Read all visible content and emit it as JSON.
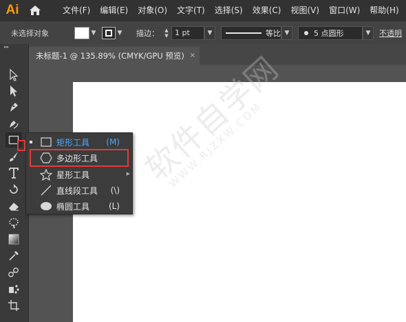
{
  "app": {
    "logo": "Ai"
  },
  "menu": [
    "文件(F)",
    "编辑(E)",
    "对象(O)",
    "文字(T)",
    "选择(S)",
    "效果(C)",
    "视图(V)",
    "窗口(W)",
    "帮助(H)"
  ],
  "control_bar": {
    "selection_label": "未选择对象",
    "stroke_label": "描边：",
    "stroke_value": "1 pt",
    "line_style_label": "等比",
    "brush_label": "5 点圆形",
    "opacity_label": "不透明"
  },
  "document_tab": {
    "title": "未标题-1 @ 135.89% (CMYK/GPU 预览)",
    "close_glyph": "×"
  },
  "flyout": {
    "items": [
      {
        "label": "矩形工具",
        "key": "(M)",
        "icon": "rectangle-icon",
        "active": true
      },
      {
        "label": "多边形工具",
        "key": "",
        "icon": "polygon-icon",
        "active": false
      },
      {
        "label": "星形工具",
        "key": "",
        "icon": "star-icon",
        "active": false
      },
      {
        "label": "直线段工具",
        "key": "(\\)",
        "icon": "line-segment-icon",
        "active": false
      },
      {
        "label": "椭圆工具",
        "key": "(L)",
        "icon": "ellipse-icon",
        "active": false
      }
    ]
  },
  "tools": [
    "selection-tool-icon",
    "direct-selection-tool-icon",
    "pen-tool-icon",
    "curvature-tool-icon",
    "rectangle-tool-icon",
    "paintbrush-tool-icon",
    "type-tool-icon",
    "rotate-tool-icon",
    "eraser-tool-icon",
    "warp-tool-icon",
    "gradient-tool-icon",
    "eyedropper-tool-icon",
    "blend-tool-icon",
    "symbol-sprayer-tool-icon",
    "artboard-tool-icon"
  ],
  "watermark": {
    "main": "软件自学网",
    "sub": "WWW.RJZXW.COM"
  },
  "colors": {
    "accent_orange": "#ff9a00",
    "highlight_red": "#e23b3b",
    "active_blue": "#4da6ff",
    "canvas": "#ffffff"
  }
}
